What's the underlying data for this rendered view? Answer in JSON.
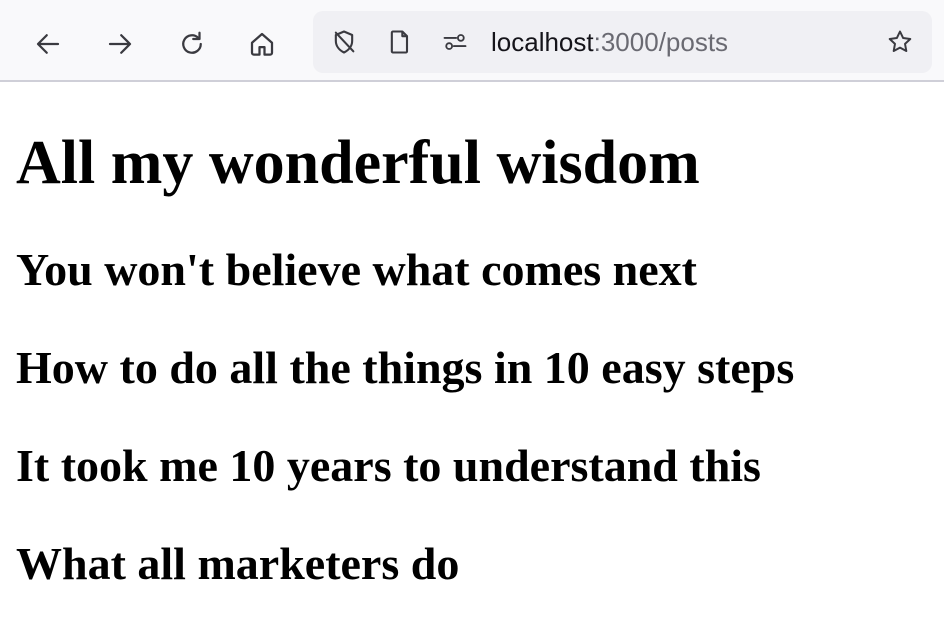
{
  "browser": {
    "url_host": "localhost",
    "url_rest": ":3000/posts",
    "icons": {
      "back": "arrow-left-icon",
      "forward": "arrow-right-icon",
      "reload": "reload-icon",
      "home": "home-icon",
      "tracking": "shield-slash-icon",
      "page": "document-icon",
      "permissions": "permissions-icon",
      "bookmark": "star-icon"
    }
  },
  "page": {
    "heading": "All my wonderful wisdom",
    "posts": [
      {
        "title": "You won't believe what comes next"
      },
      {
        "title": "How to do all the things in 10 easy steps"
      },
      {
        "title": "It took me 10 years to understand this"
      },
      {
        "title": "What all marketers do"
      }
    ]
  },
  "colors": {
    "toolbar_bg": "#f9f9fb",
    "urlbar_bg": "#f0f0f4",
    "text": "#000000",
    "url_dim": "#6a6a72"
  }
}
